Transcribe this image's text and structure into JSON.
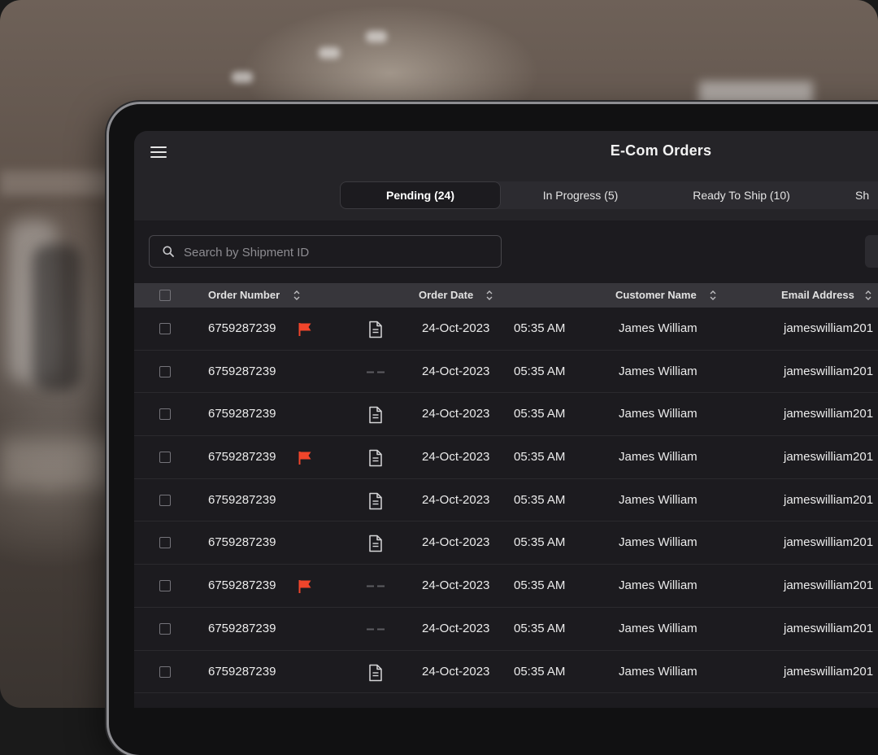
{
  "app": {
    "title": "E-Com Orders"
  },
  "tabs": [
    {
      "label": "Pending (24)",
      "active": true
    },
    {
      "label": "In Progress (5)",
      "active": false
    },
    {
      "label": "Ready To Ship (10)",
      "active": false
    },
    {
      "label": "Sh",
      "active": false
    }
  ],
  "search": {
    "placeholder": "Search by Shipment ID"
  },
  "table": {
    "columns": [
      "Order Number",
      "Order Date",
      "Customer Name",
      "Email Address"
    ],
    "rows": [
      {
        "order": "6759287239",
        "flag": true,
        "doc": true,
        "date": "24-Oct-2023",
        "time": "05:35 AM",
        "customer": "James William",
        "email": "jameswilliam201"
      },
      {
        "order": "6759287239",
        "flag": false,
        "doc": false,
        "date": "24-Oct-2023",
        "time": "05:35 AM",
        "customer": "James William",
        "email": "jameswilliam201"
      },
      {
        "order": "6759287239",
        "flag": false,
        "doc": true,
        "date": "24-Oct-2023",
        "time": "05:35 AM",
        "customer": "James William",
        "email": "jameswilliam201"
      },
      {
        "order": "6759287239",
        "flag": true,
        "doc": true,
        "date": "24-Oct-2023",
        "time": "05:35 AM",
        "customer": "James William",
        "email": "jameswilliam201"
      },
      {
        "order": "6759287239",
        "flag": false,
        "doc": true,
        "date": "24-Oct-2023",
        "time": "05:35 AM",
        "customer": "James William",
        "email": "jameswilliam201"
      },
      {
        "order": "6759287239",
        "flag": false,
        "doc": true,
        "date": "24-Oct-2023",
        "time": "05:35 AM",
        "customer": "James William",
        "email": "jameswilliam201"
      },
      {
        "order": "6759287239",
        "flag": true,
        "doc": false,
        "date": "24-Oct-2023",
        "time": "05:35 AM",
        "customer": "James William",
        "email": "jameswilliam201"
      },
      {
        "order": "6759287239",
        "flag": false,
        "doc": false,
        "date": "24-Oct-2023",
        "time": "05:35 AM",
        "customer": "James William",
        "email": "jameswilliam201"
      },
      {
        "order": "6759287239",
        "flag": false,
        "doc": true,
        "date": "24-Oct-2023",
        "time": "05:35 AM",
        "customer": "James William",
        "email": "jameswilliam201"
      }
    ]
  },
  "colors": {
    "flag": "#f0452b",
    "accent": "#ffffff",
    "background": "#1c1b1f"
  },
  "icons": [
    "menu-icon",
    "search-icon",
    "sort-icon",
    "flag-icon",
    "document-icon",
    "dash-icon"
  ]
}
